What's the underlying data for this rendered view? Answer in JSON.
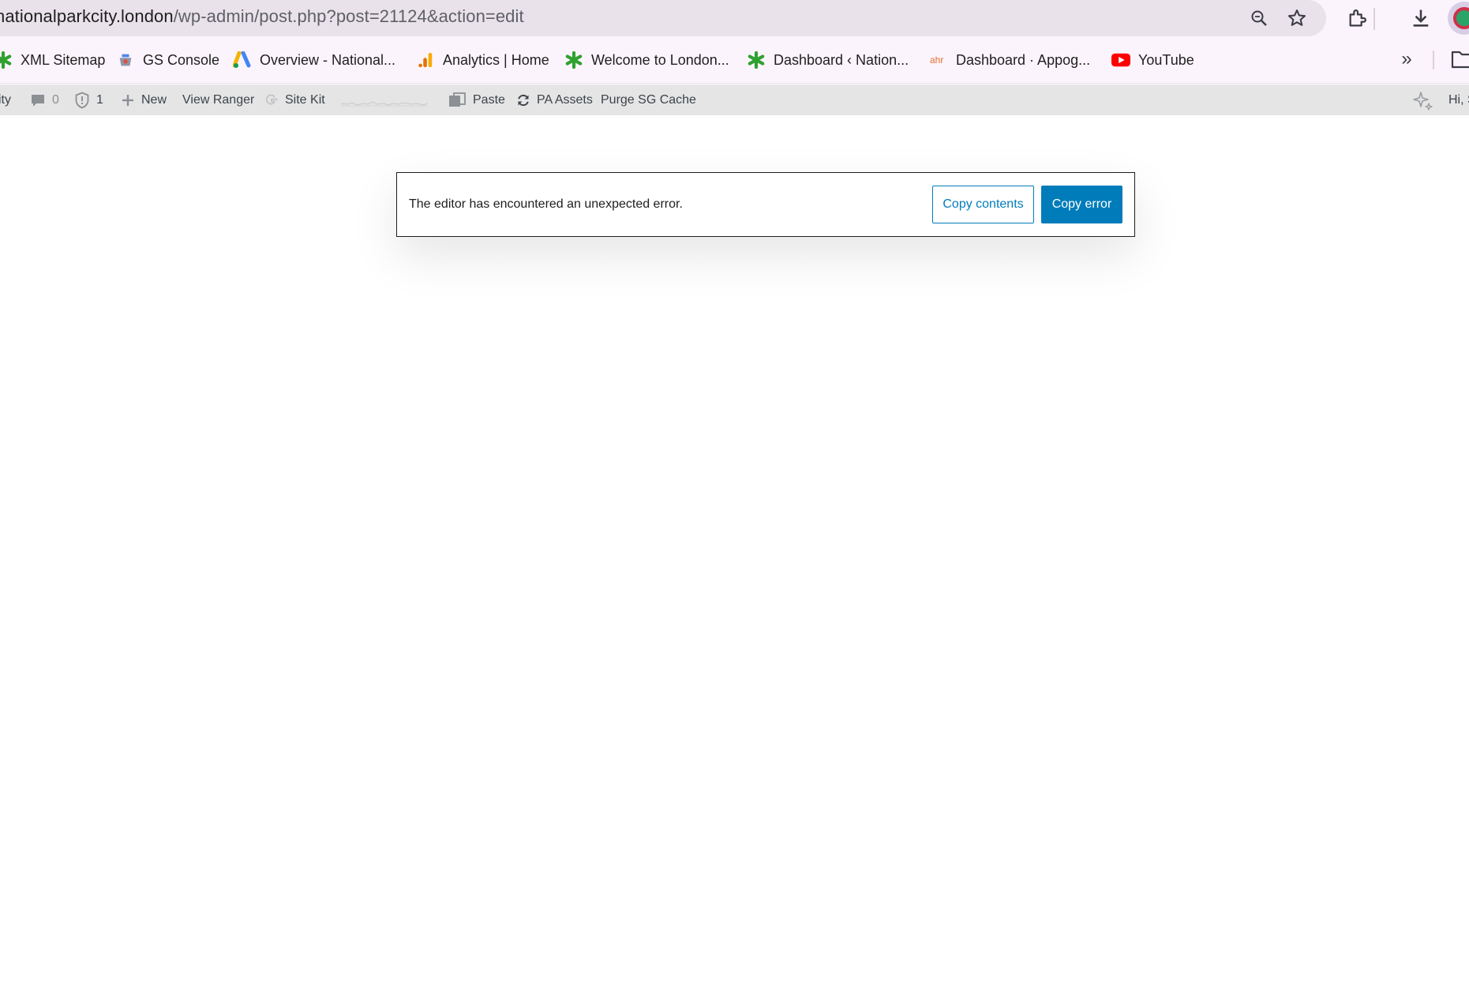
{
  "browser": {
    "url_host": "nationalparkcity.london",
    "url_path": "/wp-admin/post.php?post=21124&action=edit",
    "toolbar_icons": [
      "zoom-icon",
      "bookmark-star-icon",
      "extensions-icon",
      "download-icon",
      "profile-avatar"
    ]
  },
  "bookmarks": {
    "items": [
      {
        "label": "XML Sitemap",
        "icon": "green-star-icon"
      },
      {
        "label": "GS Console",
        "icon": "gs-console-icon"
      },
      {
        "label": "Overview - National...",
        "icon": "google-ads-icon"
      },
      {
        "label": "Analytics | Home",
        "icon": "analytics-icon"
      },
      {
        "label": "Welcome to London...",
        "icon": "green-star-icon"
      },
      {
        "label": "Dashboard ‹ Nation...",
        "icon": "green-star-icon"
      },
      {
        "label": "Dashboard · Appog...",
        "icon": "ahrefs-icon"
      },
      {
        "label": "YouTube",
        "icon": "youtube-icon"
      }
    ],
    "overflow_label": "»",
    "overflow_icon": "chevron-double-right-icon",
    "folder_icon": "folder-icon"
  },
  "adminbar": {
    "site_fragment": "ity",
    "comments_count": "0",
    "updates_count": "1",
    "new_label": "New",
    "view_label": "View Ranger",
    "sitekit_label": "Site Kit",
    "paste_label": "Paste",
    "assets_label": "PA Assets",
    "purge_label": "Purge SG Cache",
    "greeting": "Hi, S"
  },
  "notice": {
    "message": "The editor has encountered an unexpected error.",
    "copy_contents_label": "Copy contents",
    "copy_error_label": "Copy error"
  },
  "colors": {
    "wp_blue": "#007cba",
    "adminbar_bg": "#e5e5e5",
    "chrome_bg": "#fcf4fc",
    "omnibox_bg": "#e9e2ea"
  }
}
